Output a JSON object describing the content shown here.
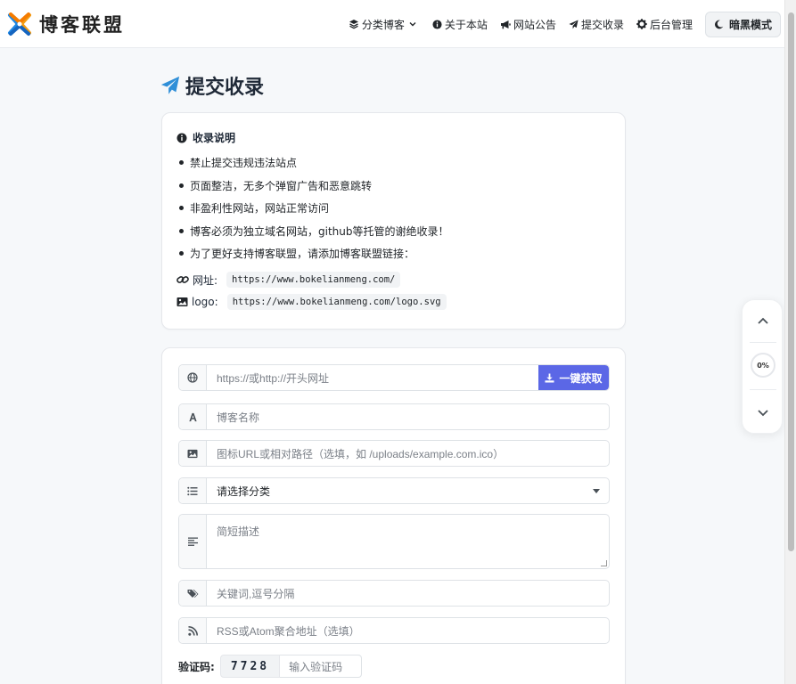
{
  "header": {
    "brand": "博客联盟",
    "nav": [
      {
        "label": "分类博客",
        "icon": "layers-icon"
      },
      {
        "label": "关于本站",
        "icon": "info-icon"
      },
      {
        "label": "网站公告",
        "icon": "megaphone-icon"
      },
      {
        "label": "提交收录",
        "icon": "paper-plane-icon"
      },
      {
        "label": "后台管理",
        "icon": "gear-icon"
      }
    ],
    "dark_mode": "暗黑模式"
  },
  "page": {
    "title": "提交收录"
  },
  "notice": {
    "heading": "收录说明",
    "rules": [
      "禁止提交违规违法站点",
      "页面整洁，无多个弹窗广告和恶意跳转",
      "非盈利性网站，网站正常访问",
      "博客必须为独立域名网站，github等托管的谢绝收录！",
      "为了更好支持博客联盟，请添加博客联盟链接："
    ],
    "url_label": "网址:",
    "url_value": "https://www.bokelianmeng.com/",
    "logo_label": "logo:",
    "logo_value": "https://www.bokelianmeng.com/logo.svg"
  },
  "form": {
    "url_placeholder": "https://或http://开头网址",
    "fetch_button": "一键获取",
    "name_placeholder": "博客名称",
    "icon_placeholder": "图标URL或相对路径（选填，如 /uploads/example.com.ico）",
    "category_selected": "请选择分类",
    "description_placeholder": "简短描述",
    "keywords_placeholder": "关键词,逗号分隔",
    "rss_placeholder": "RSS或Atom聚合地址（选填）",
    "captcha_label": "验证码:",
    "captcha_code": "7728",
    "captcha_placeholder": "输入验证码"
  },
  "widget": {
    "progress": "0%"
  },
  "colors": {
    "accent": "#5b67e6",
    "title_icon": "#2f8fd8"
  }
}
